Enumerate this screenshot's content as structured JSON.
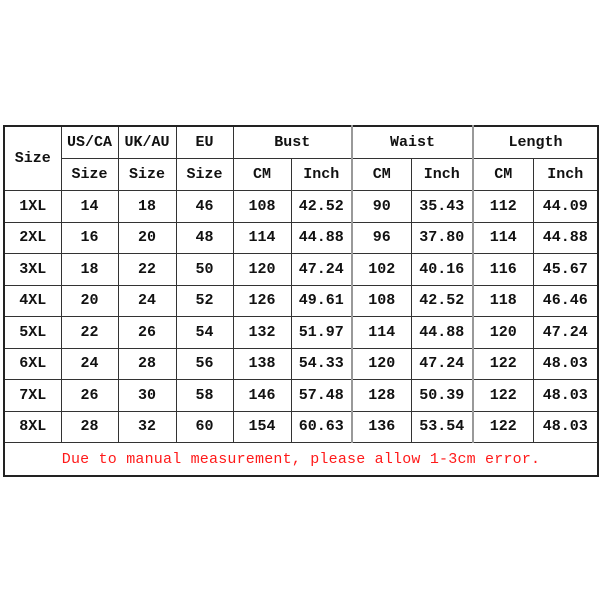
{
  "header": {
    "size": "Size",
    "us_ca": "US/CA",
    "uk_au": "UK/AU",
    "eu": "EU",
    "bust": "Bust",
    "waist": "Waist",
    "length": "Length",
    "sub": [
      "Size",
      "Size",
      "Size",
      "CM",
      "Inch",
      "CM",
      "Inch",
      "CM",
      "Inch"
    ]
  },
  "rows": [
    [
      "1XL",
      "14",
      "18",
      "46",
      "108",
      "42.52",
      "90",
      "35.43",
      "112",
      "44.09"
    ],
    [
      "2XL",
      "16",
      "20",
      "48",
      "114",
      "44.88",
      "96",
      "37.80",
      "114",
      "44.88"
    ],
    [
      "3XL",
      "18",
      "22",
      "50",
      "120",
      "47.24",
      "102",
      "40.16",
      "116",
      "45.67"
    ],
    [
      "4XL",
      "20",
      "24",
      "52",
      "126",
      "49.61",
      "108",
      "42.52",
      "118",
      "46.46"
    ],
    [
      "5XL",
      "22",
      "26",
      "54",
      "132",
      "51.97",
      "114",
      "44.88",
      "120",
      "47.24"
    ],
    [
      "6XL",
      "24",
      "28",
      "56",
      "138",
      "54.33",
      "120",
      "47.24",
      "122",
      "48.03"
    ],
    [
      "7XL",
      "26",
      "30",
      "58",
      "146",
      "57.48",
      "128",
      "50.39",
      "122",
      "48.03"
    ],
    [
      "8XL",
      "28",
      "32",
      "60",
      "154",
      "60.63",
      "136",
      "53.54",
      "122",
      "48.03"
    ]
  ],
  "note": "Due to manual measurement, please allow 1-3cm error.",
  "colors": {
    "note": "#ff1a1a",
    "border": "#333333"
  }
}
